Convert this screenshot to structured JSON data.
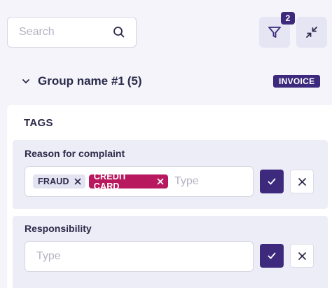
{
  "search": {
    "placeholder": "Search",
    "icon": "search-icon"
  },
  "toolbar": {
    "filter_icon": "filter-icon",
    "filter_count": "2",
    "collapse_icon": "collapse-icon"
  },
  "group": {
    "title": "Group name #1",
    "count": "(5)",
    "badge": "INVOICE",
    "expanded": true
  },
  "tags_section": {
    "title": "TAGS",
    "fields": [
      {
        "label": "Reason for complaint",
        "chips": [
          "FRAUD",
          "CREDIT CARD"
        ],
        "input_placeholder": "Type"
      },
      {
        "label": "Responsibility",
        "chips": [],
        "input_placeholder": "Type"
      }
    ]
  },
  "colors": {
    "accent": "#3d2a7c",
    "chip_highlight": "#b8195e",
    "chip_default": "#e3e3f2",
    "background": "#f4f4fa",
    "card_background": "#ededf7"
  }
}
